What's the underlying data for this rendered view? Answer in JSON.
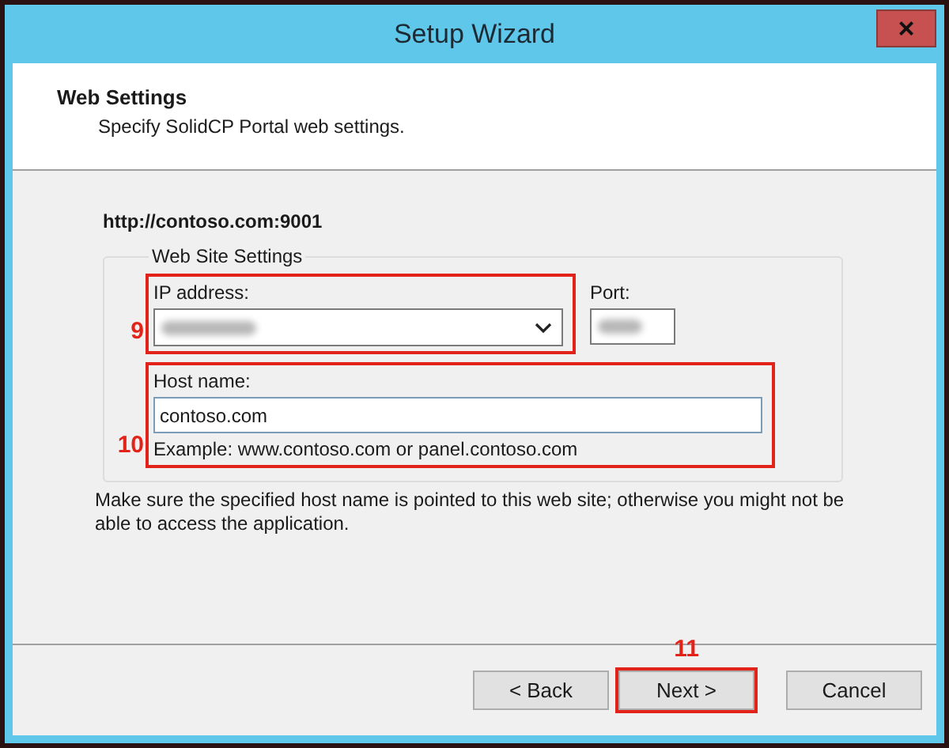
{
  "window": {
    "title": "Setup Wizard",
    "close": "×"
  },
  "header": {
    "title": "Web Settings",
    "subtitle": "Specify SolidCP Portal web settings."
  },
  "url": "http://contoso.com:9001",
  "group": {
    "legend": "Web Site Settings",
    "ip_address": {
      "label": "IP address:",
      "annotation": "9"
    },
    "port": {
      "label": "Port:"
    },
    "host_name": {
      "label": "Host name:",
      "value": "contoso.com",
      "example": "Example: www.contoso.com or panel.contoso.com",
      "annotation": "10"
    }
  },
  "note": "Make sure the specified host name is pointed to this web site; otherwise you might not be able to access the application.",
  "buttons": [
    {
      "label": "< Back"
    },
    {
      "label": "Next >",
      "annotation": "11"
    },
    {
      "label": "Cancel"
    }
  ]
}
